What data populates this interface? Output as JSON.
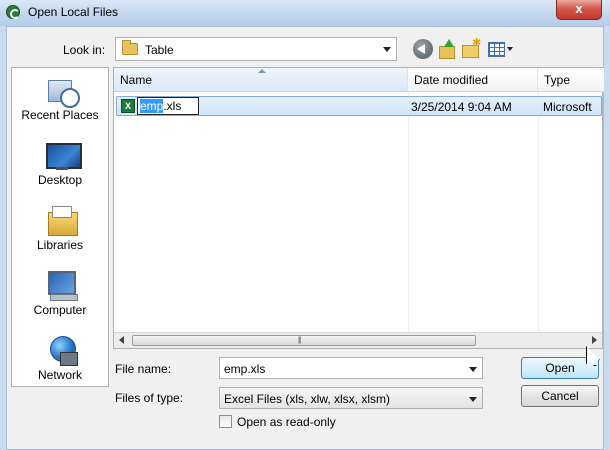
{
  "window": {
    "title": "Open Local Files",
    "close_label": "x"
  },
  "toolbar": {
    "look_in_label": "Look in:",
    "look_in_value": "Table",
    "icons": [
      "back-icon",
      "up-folder-icon",
      "new-folder-icon",
      "views-menu-icon"
    ]
  },
  "places": {
    "items": [
      {
        "label": "Recent Places",
        "icon": "recent-places-icon"
      },
      {
        "label": "Desktop",
        "icon": "desktop-icon"
      },
      {
        "label": "Libraries",
        "icon": "libraries-icon"
      },
      {
        "label": "Computer",
        "icon": "computer-icon"
      },
      {
        "label": "Network",
        "icon": "network-icon"
      }
    ]
  },
  "filelist": {
    "columns": [
      "Name",
      "Date modified",
      "Type"
    ],
    "files": [
      {
        "name_selected": "emp",
        "name_rest": ".xls",
        "date": "3/25/2014 9:04 AM",
        "type": "Microsoft",
        "icon_letter": "X"
      }
    ]
  },
  "form": {
    "file_name_label": "File name:",
    "file_name_value": "emp.xls",
    "file_type_label": "Files of type:",
    "file_type_value": "Excel Files (xls, xlw, xlsx, xlsm)",
    "readonly_label": "Open as read-only"
  },
  "buttons": {
    "open": "Open",
    "cancel": "Cancel"
  },
  "colors": {
    "selection": "#3399ff",
    "title_bar": "#c2d6ee",
    "close_button": "#c2382a"
  }
}
